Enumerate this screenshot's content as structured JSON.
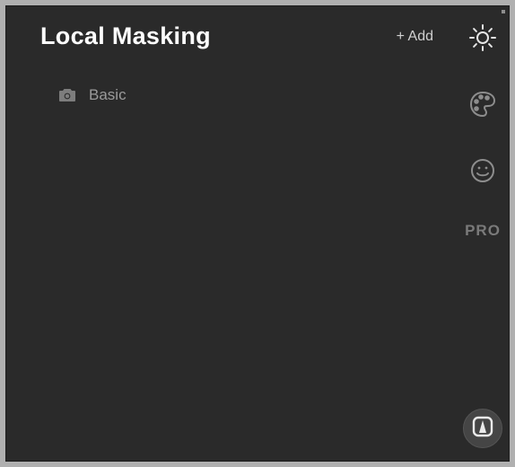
{
  "panel": {
    "title": "Local Masking",
    "add_label": "+ Add"
  },
  "items": [
    {
      "label": "Basic",
      "icon": "camera-icon"
    }
  ],
  "sidebar": {
    "sun": "sun-icon",
    "palette": "palette-icon",
    "smile": "smile-icon",
    "pro_label": "PRO",
    "mask": "mask-tool-icon"
  }
}
